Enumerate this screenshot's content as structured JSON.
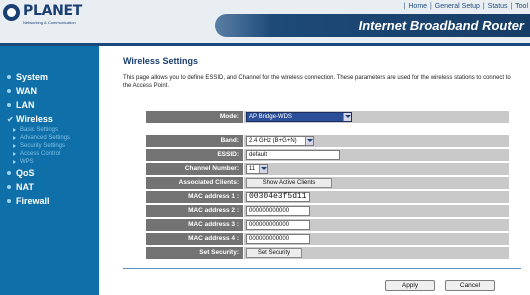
{
  "brand": {
    "name": "PLANET",
    "tagline": "Networking & Communication",
    "product_title": "Internet Broadband Router"
  },
  "topnav": {
    "items": [
      "Home",
      "General Setup",
      "Status",
      "Tool"
    ]
  },
  "sidebar": {
    "items": [
      {
        "label": "System"
      },
      {
        "label": "WAN"
      },
      {
        "label": "LAN"
      },
      {
        "label": "Wireless",
        "active": true,
        "subitems": [
          "Basic Settings",
          "Advanced Settings",
          "Security Settings",
          "Access Control",
          "WPS"
        ]
      },
      {
        "label": "QoS"
      },
      {
        "label": "NAT"
      },
      {
        "label": "Firewall"
      }
    ]
  },
  "page": {
    "title": "Wireless Settings",
    "description": "This page allows you to define ESSID, and Channel for the wireless connection. These parameters are used for the wireless stations to connect to the Access Point."
  },
  "form": {
    "mode": {
      "label": "Mode:",
      "value": "AP Bridge-WDS"
    },
    "band": {
      "label": "Band:",
      "value": "2.4 GHz (B+G+N)"
    },
    "essid": {
      "label": "ESSID:",
      "value": "default"
    },
    "channel": {
      "label": "Channel Number:",
      "value": "11"
    },
    "clients": {
      "label": "Associated Clients:",
      "button": "Show Active Clients"
    },
    "mac": [
      {
        "label": "MAC address 1 :",
        "value": "00304e3f5d11"
      },
      {
        "label": "MAC address 2 :",
        "value": "000000000000"
      },
      {
        "label": "MAC address 3 :",
        "value": "000000000000"
      },
      {
        "label": "MAC address 4 :",
        "value": "000000000000"
      }
    ],
    "security": {
      "label": "Set Security:",
      "button": "Set Security"
    }
  },
  "actions": {
    "apply": "Apply",
    "cancel": "Cancel"
  },
  "colors": {
    "sidebar_bg": "#0f6fa8",
    "title_bar": "#163d66",
    "label_bg": "#737373",
    "value_bg": "#c9c9c9"
  }
}
